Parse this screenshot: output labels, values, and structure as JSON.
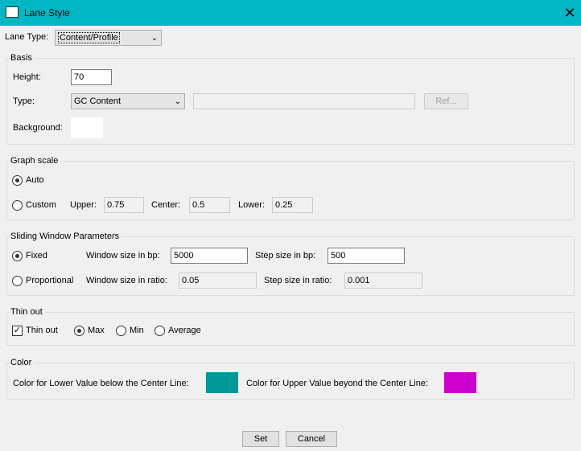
{
  "window": {
    "title": "Lane Style",
    "close_glyph": "✕",
    "icon": "app-icon"
  },
  "lane_type": {
    "label": "Lane Type:",
    "value": "Content/Profile"
  },
  "basis": {
    "title": "Basis",
    "height_label": "Height:",
    "height_value": "70",
    "type_label": "Type:",
    "type_value": "GC Content",
    "type_text": "",
    "ref_label": "Ref...",
    "background_label": "Background:",
    "background_color": "#ffffff"
  },
  "graph_scale": {
    "title": "Graph scale",
    "auto_label": "Auto",
    "custom_label": "Custom",
    "selected": "auto",
    "upper_label": "Upper:",
    "upper_value": "0.75",
    "center_label": "Center:",
    "center_value": "0.5",
    "lower_label": "Lower:",
    "lower_value": "0.25"
  },
  "sliding_window": {
    "title": "Sliding Window Parameters",
    "fixed_label": "Fixed",
    "proportional_label": "Proportional",
    "selected": "fixed",
    "window_bp_label": "Window size in bp:",
    "window_bp_value": "5000",
    "step_bp_label": "Step size in bp:",
    "step_bp_value": "500",
    "window_ratio_label": "Window size in ratio:",
    "window_ratio_value": "0.05",
    "step_ratio_label": "Step size in ratio:",
    "step_ratio_value": "0.001"
  },
  "thin_out": {
    "title": "Thin out",
    "checkbox_label": "Thin out",
    "checked": true,
    "max_label": "Max",
    "min_label": "Min",
    "average_label": "Average",
    "selected": "max"
  },
  "color": {
    "title": "Color",
    "lower_label": "Color for Lower Value below the Center Line:",
    "lower_color": "#009999",
    "upper_label": "Color for Upper Value beyond the Center Line:",
    "upper_color": "#cc00cc"
  },
  "buttons": {
    "set_label": "Set",
    "cancel_label": "Cancel"
  }
}
